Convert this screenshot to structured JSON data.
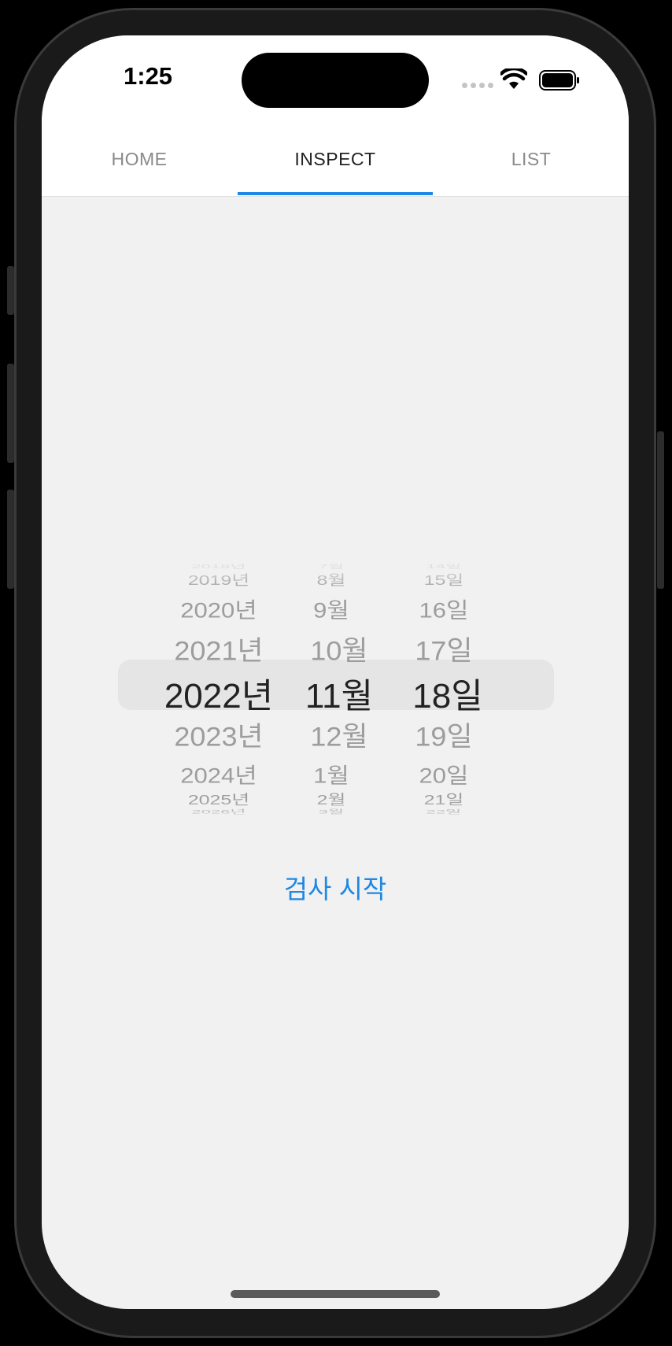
{
  "status_bar": {
    "time": "1:25"
  },
  "tabs": [
    {
      "label": "HOME",
      "active": false
    },
    {
      "label": "INSPECT",
      "active": true
    },
    {
      "label": "LIST",
      "active": false
    }
  ],
  "date_picker": {
    "years": [
      "2018년",
      "2019년",
      "2020년",
      "2021년",
      "2022년",
      "2023년",
      "2024년",
      "2025년",
      "2026년"
    ],
    "months": [
      "7월",
      "8월",
      "9월",
      "10월",
      "11월",
      "12월",
      "1월",
      "2월",
      "3월"
    ],
    "days": [
      "14일",
      "15일",
      "16일",
      "17일",
      "18일",
      "19일",
      "20일",
      "21일",
      "22일"
    ],
    "selected_year": "2022년",
    "selected_month": "11월",
    "selected_day": "18일"
  },
  "actions": {
    "start_inspection_label": "검사 시작"
  },
  "colors": {
    "accent": "#1e88e5",
    "background": "#f1f1f1"
  }
}
